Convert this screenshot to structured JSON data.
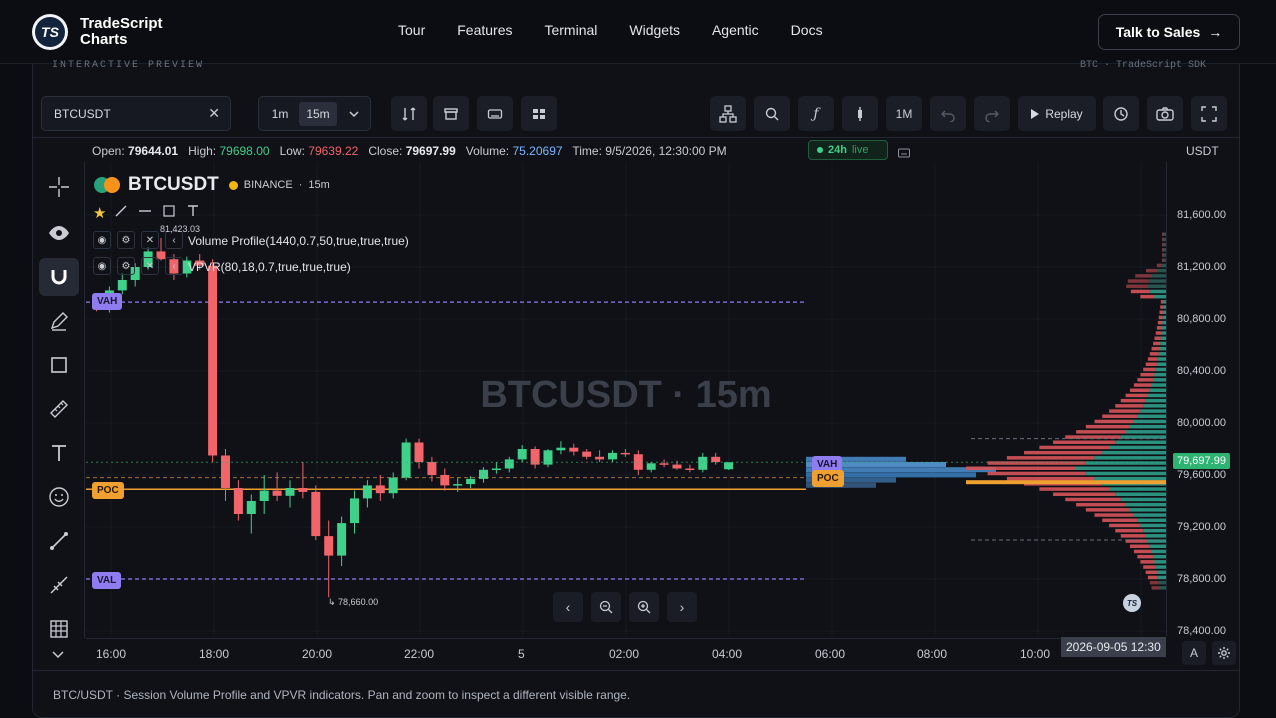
{
  "nav": {
    "brand_line1": "TradeScript",
    "brand_line2": "Charts",
    "logo_text": "TS",
    "links": [
      "Tour",
      "Features",
      "Terminal",
      "Widgets",
      "Agentic",
      "Docs"
    ],
    "cta": "Talk to Sales",
    "cta_arrow": "→"
  },
  "preview": {
    "left_label": "INTERACTIVE PREVIEW",
    "right_label": "BTC · TradeScript SDK"
  },
  "toolbar": {
    "symbol": "BTCUSDT",
    "clear": "✕",
    "timeframes": [
      "1m",
      "15m"
    ],
    "active_timeframe": "15m",
    "range_label": "1M",
    "replay_label": "Replay"
  },
  "ohlc": {
    "open_label": "Open:",
    "open": "79644.01",
    "high_label": "High:",
    "high": "79698.00",
    "low_label": "Low:",
    "low": "79639.22",
    "close_label": "Close:",
    "close": "79697.99",
    "volume_label": "Volume:",
    "volume": "75.20697",
    "time_label": "Time:",
    "time": "9/5/2026, 12:30:00 PM"
  },
  "live_badge": {
    "range": "24h",
    "status": "live"
  },
  "currency": "USDT",
  "chart_header": {
    "symbol": "BTCUSDT",
    "exchange": "BINANCE",
    "interval": "15m",
    "watermark": "BTCUSDT · 15m"
  },
  "indicators": [
    "Volume Profile(1440,0.7,50,true,true,true)",
    "VPVR(80,18,0.7,true,true,true)"
  ],
  "annotations": {
    "high_marker": "81,423.03",
    "low_marker": "78,660.00",
    "vah": "VAH",
    "poc": "POC",
    "val": "VAL"
  },
  "price_axis": {
    "labels": [
      "81,600.00",
      "81,200.00",
      "80,800.00",
      "80,400.00",
      "80,000.00",
      "79,600.00",
      "79,200.00",
      "78,800.00",
      "78,400.00"
    ],
    "last_price": "79,697.99"
  },
  "time_axis": {
    "labels": [
      "16:00",
      "18:00",
      "20:00",
      "22:00",
      "5",
      "02:00",
      "04:00",
      "06:00",
      "08:00",
      "10:00"
    ],
    "crosshair_time": "2026-09-05 12:30",
    "auto_label": "A"
  },
  "footer_text": "BTC/USDT · Session Volume Profile and VPVR indicators. Pan and zoom to inspect a different visible range.",
  "colors": {
    "up": "#3fd08a",
    "down": "#f0646a",
    "poc": "#f0a030",
    "vah_val": "#8f7cf0",
    "accent": "#3fd08a"
  },
  "chart_data": {
    "type": "candlestick",
    "interval": "15m",
    "ylim": [
      78400,
      81700
    ],
    "candles": [
      [
        80920,
        80960,
        80860,
        80880
      ],
      [
        80880,
        81050,
        80850,
        81020
      ],
      [
        81020,
        81150,
        80990,
        81100
      ],
      [
        81100,
        81230,
        81050,
        81200
      ],
      [
        81200,
        81350,
        81180,
        81320
      ],
      [
        81320,
        81423,
        81250,
        81260
      ],
      [
        81260,
        81300,
        81100,
        81150
      ],
      [
        81150,
        81280,
        81120,
        81250
      ],
      [
        81250,
        81300,
        81180,
        81210
      ],
      [
        81210,
        81260,
        79700,
        79750
      ],
      [
        79750,
        79800,
        79400,
        79500
      ],
      [
        79500,
        79560,
        79250,
        79300
      ],
      [
        79300,
        79450,
        79150,
        79400
      ],
      [
        79400,
        79600,
        79300,
        79480
      ],
      [
        79480,
        79620,
        79400,
        79440
      ],
      [
        79440,
        79560,
        79350,
        79500
      ],
      [
        79500,
        79700,
        79420,
        79470
      ],
      [
        79470,
        79520,
        79100,
        79130
      ],
      [
        79130,
        79250,
        78660,
        78980
      ],
      [
        78980,
        79280,
        78900,
        79230
      ],
      [
        79230,
        79480,
        79150,
        79420
      ],
      [
        79420,
        79560,
        79350,
        79520
      ],
      [
        79520,
        79600,
        79400,
        79460
      ],
      [
        79460,
        79620,
        79420,
        79580
      ],
      [
        79580,
        79880,
        79560,
        79850
      ],
      [
        79850,
        79880,
        79650,
        79700
      ],
      [
        79700,
        79740,
        79550,
        79600
      ],
      [
        79600,
        79650,
        79480,
        79520
      ],
      [
        79520,
        79580,
        79470,
        79530
      ],
      [
        79530,
        79590,
        79500,
        79570
      ],
      [
        79570,
        79660,
        79540,
        79640
      ],
      [
        79640,
        79700,
        79610,
        79650
      ],
      [
        79650,
        79740,
        79620,
        79720
      ],
      [
        79720,
        79830,
        79700,
        79800
      ],
      [
        79800,
        79820,
        79650,
        79680
      ],
      [
        79680,
        79800,
        79660,
        79790
      ],
      [
        79790,
        79860,
        79760,
        79810
      ],
      [
        79810,
        79840,
        79750,
        79780
      ],
      [
        79780,
        79800,
        79720,
        79740
      ],
      [
        79740,
        79790,
        79700,
        79720
      ],
      [
        79720,
        79790,
        79700,
        79770
      ],
      [
        79770,
        79800,
        79740,
        79760
      ],
      [
        79760,
        79790,
        79600,
        79640
      ],
      [
        79640,
        79700,
        79620,
        79690
      ],
      [
        79690,
        79720,
        79660,
        79680
      ],
      [
        79680,
        79710,
        79640,
        79650
      ],
      [
        79650,
        79680,
        79620,
        79640
      ],
      [
        79640,
        79770,
        79620,
        79740
      ],
      [
        79740,
        79770,
        79680,
        79700
      ],
      [
        79644.01,
        79698,
        79639.22,
        79697.99
      ]
    ],
    "levels": {
      "vah": 80930,
      "poc": 79490,
      "val": 78800
    },
    "last_price": 79697.99
  }
}
